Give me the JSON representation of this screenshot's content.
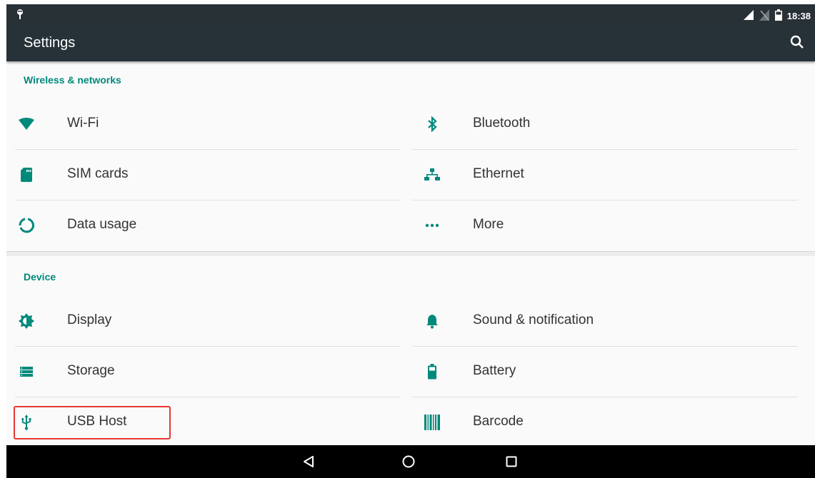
{
  "status_bar": {
    "time": "18:38"
  },
  "app_bar": {
    "title": "Settings"
  },
  "sections": {
    "wireless": {
      "title": "Wireless & networks",
      "items": [
        {
          "label": "Wi-Fi",
          "icon": "wifi-icon"
        },
        {
          "label": "Bluetooth",
          "icon": "bluetooth-icon"
        },
        {
          "label": "SIM cards",
          "icon": "sim-card-icon"
        },
        {
          "label": "Ethernet",
          "icon": "ethernet-icon"
        },
        {
          "label": "Data usage",
          "icon": "data-usage-icon"
        },
        {
          "label": "More",
          "icon": "more-icon"
        }
      ]
    },
    "device": {
      "title": "Device",
      "items": [
        {
          "label": "Display",
          "icon": "display-icon"
        },
        {
          "label": "Sound & notification",
          "icon": "bell-icon"
        },
        {
          "label": "Storage",
          "icon": "storage-icon"
        },
        {
          "label": "Battery",
          "icon": "battery-icon"
        },
        {
          "label": "USB Host",
          "icon": "usb-icon"
        },
        {
          "label": "Barcode",
          "icon": "barcode-icon"
        }
      ]
    }
  },
  "colors": {
    "accent": "#00897b",
    "app_bar": "#263238",
    "highlight": "#e53935"
  }
}
